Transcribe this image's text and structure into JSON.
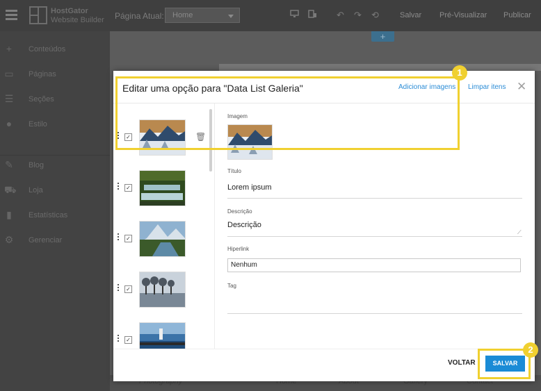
{
  "topbar": {
    "brand_line1": "HostGator",
    "brand_line2": "Website Builder",
    "page_label": "Página Atual:",
    "page_select": "Home",
    "save": "Salvar",
    "preview": "Pré-Visualizar",
    "publish": "Publicar"
  },
  "sidebar": {
    "items": [
      {
        "label": "Conteúdos",
        "icon": "plus-icon"
      },
      {
        "label": "Páginas",
        "icon": "pages-icon"
      },
      {
        "label": "Seções",
        "icon": "sections-icon"
      },
      {
        "label": "Estilo",
        "icon": "palette-icon"
      },
      {
        "label": "Blog",
        "icon": "pencil-icon"
      },
      {
        "label": "Loja",
        "icon": "cart-icon"
      },
      {
        "label": "Estatísticas",
        "icon": "bar-chart-icon"
      },
      {
        "label": "Gerenciar",
        "icon": "gear-icon"
      }
    ]
  },
  "canvas": {
    "footer_items": [
      "Photography",
      "Home",
      "About",
      "Gallery",
      "Contact"
    ]
  },
  "modal": {
    "title": "Editar uma opção para \"Data List Galeria\"",
    "add_images": "Adicionar imagens",
    "clear_items": "Limpar itens",
    "fields": {
      "image_label": "Imagem",
      "title_label": "Título",
      "title_value": "Lorem ipsum",
      "description_label": "Descrição",
      "description_value": "Descrição",
      "hyperlink_label": "Hiperlink",
      "hyperlink_value": "Nenhum",
      "tag_label": "Tag"
    },
    "back": "VOLTAR",
    "save": "SALVAR"
  },
  "annotations": {
    "badge1": "1",
    "badge2": "2"
  },
  "colors": {
    "accent": "#1a8bd6",
    "highlight": "#f0d030"
  }
}
